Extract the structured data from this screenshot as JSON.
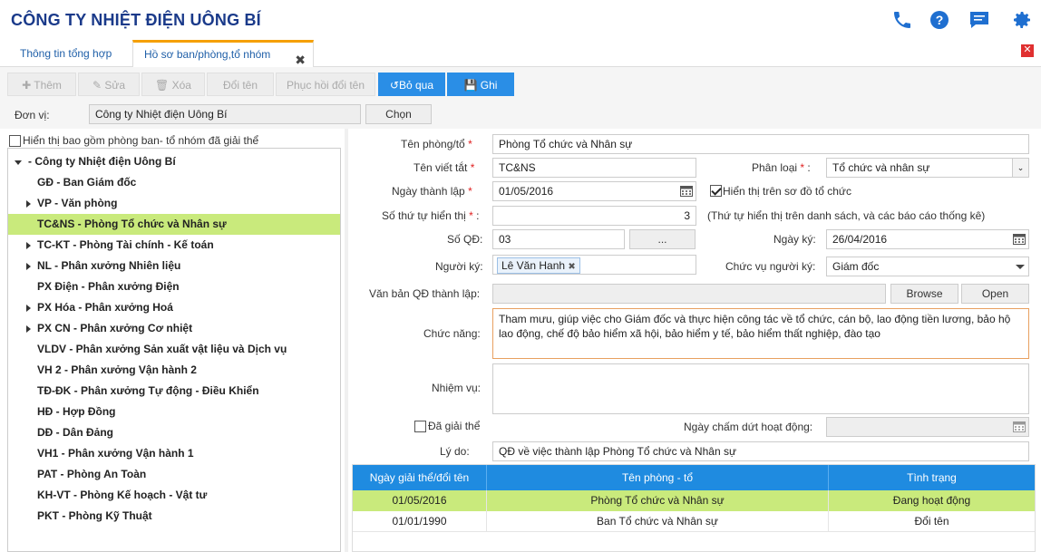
{
  "header": {
    "title": "CÔNG TY NHIỆT ĐIỆN UÔNG BÍ",
    "icons": [
      "phone-icon",
      "help-icon",
      "chat-icon",
      "gear-icon"
    ],
    "icon_color": "#1f6fd0"
  },
  "tabs": [
    {
      "label": "Thông tin tổng hợp",
      "active": false
    },
    {
      "label": "Hồ sơ ban/phòng,tổ nhóm",
      "active": true,
      "close": "✖"
    }
  ],
  "window_close": "✕",
  "toolbar": {
    "add": "Thêm",
    "edit": "Sửa",
    "delete": "Xóa",
    "rename": "Đổi tên",
    "restore_name": "Phục hồi đổi tên",
    "skip": "Bỏ qua",
    "save": "Ghi"
  },
  "unit": {
    "label": "Đơn vị:",
    "value": "Công ty Nhiệt điện Uông Bí",
    "choose": "Chọn"
  },
  "show_dissolved": {
    "label": "Hiển thị bao gồm phòng ban- tổ nhóm đã giải thể",
    "checked": false
  },
  "tree": {
    "root": "- Công ty Nhiệt điện Uông Bí",
    "items": [
      {
        "label": "GĐ - Ban Giám đốc",
        "arrow": false
      },
      {
        "label": "VP - Văn phòng",
        "arrow": true
      },
      {
        "label": "TC&NS - Phòng Tổ chức và Nhân sự",
        "arrow": false,
        "selected": true
      },
      {
        "label": "TC-KT - Phòng Tài chính - Kế toán",
        "arrow": true
      },
      {
        "label": "NL - Phân xưởng Nhiên liệu",
        "arrow": true
      },
      {
        "label": "PX Điện - Phân xưởng Điện",
        "arrow": false
      },
      {
        "label": "PX Hóa - Phân xưởng Hoá",
        "arrow": true
      },
      {
        "label": "PX CN - Phân xưởng Cơ nhiệt",
        "arrow": true
      },
      {
        "label": "VLDV - Phân xưởng Sản xuất vật liệu và Dịch vụ",
        "arrow": false
      },
      {
        "label": "VH 2 - Phân xưởng Vận hành 2",
        "arrow": false
      },
      {
        "label": "TĐ-ĐK - Phân xưởng Tự động - Điều Khiển",
        "arrow": false
      },
      {
        "label": "HĐ - Hợp Đồng",
        "arrow": false
      },
      {
        "label": "DĐ - Dân Đảng",
        "arrow": false
      },
      {
        "label": "VH1 - Phân xưởng Vận hành 1",
        "arrow": false
      },
      {
        "label": "PAT - Phòng An Toàn",
        "arrow": false
      },
      {
        "label": "KH-VT - Phòng Kế hoạch - Vật tư",
        "arrow": false
      },
      {
        "label": "PKT - Phòng Kỹ Thuật",
        "arrow": false
      }
    ]
  },
  "form": {
    "name_label": "Tên phòng/tổ",
    "name_value": "Phòng Tổ chức và Nhân sự",
    "abbr_label": "Tên viết tắt",
    "abbr_value": "TC&NS",
    "type_label": "Phân loại",
    "type_value": "Tổ chức và nhân sự",
    "founded_label": "Ngày thành lập",
    "founded_value": "01/05/2016",
    "show_org_label": "Hiển thị trên sơ đồ tổ chức",
    "show_org_checked": true,
    "order_label": "Số thứ tự hiển thị",
    "order_value": "3",
    "order_hint": "(Thứ tự hiển thị trên danh sách, và các báo cáo thống kê)",
    "decision_label": "Số QĐ:",
    "decision_value": "03",
    "decision_btn": "...",
    "sign_date_label": "Ngày ký:",
    "sign_date_value": "26/04/2016",
    "signer_label": "Người ký:",
    "signer_value": "Lê Văn Hanh",
    "signer_pos_label": "Chức vụ người ký:",
    "signer_pos_value": "Giám đốc",
    "doc_label": "Văn bản QĐ thành lập:",
    "doc_value": "",
    "browse": "Browse",
    "open": "Open",
    "function_label": "Chức năng:",
    "function_value": "Tham mưu, giúp việc cho Giám đốc và thực hiện công tác về tổ chức, cán bộ, lao động tiền lương, bảo hộ lao động, chế độ bảo hiểm xã hội, bảo hiểm y tế, bảo hiểm thất nghiệp, đào tạo",
    "duty_label": "Nhiệm vụ:",
    "duty_value": "",
    "dissolved_label": "Đã giải thể",
    "dissolved_checked": false,
    "end_date_label": "Ngày chấm dứt hoạt động:",
    "end_date_value": "",
    "reason_label": "Lý do:",
    "reason_value": "QĐ về việc thành lập Phòng Tổ chức và Nhân sự",
    "required_mark": "*"
  },
  "history": {
    "columns": [
      "Ngày giải thể/đổi tên",
      "Tên phòng - tổ",
      "Tình trạng"
    ],
    "rows": [
      {
        "date": "01/05/2016",
        "name": "Phòng Tổ chức và Nhân sự",
        "status": "Đang hoạt động",
        "highlight": true
      },
      {
        "date": "01/01/1990",
        "name": "Ban Tổ chức và Nhân sự",
        "status": "Đổi tên",
        "highlight": false
      }
    ]
  },
  "colors": {
    "accent": "#1f8be0",
    "selected_row": "#c9ea7c",
    "title": "#1a3a8a",
    "tab_accent": "#f5a000",
    "required": "#e02020"
  }
}
